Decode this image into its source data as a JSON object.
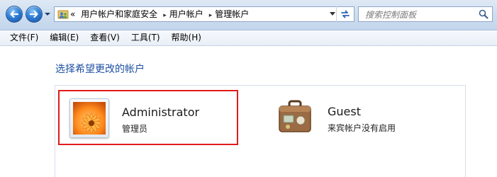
{
  "address_bar": {
    "overflow_glyph": "«",
    "breadcrumbs": [
      "用户帐户和家庭安全",
      "用户帐户",
      "管理帐户"
    ],
    "separator_glyph": "▸",
    "icons": {
      "location": "users-folder-icon",
      "refresh": "refresh-icon",
      "dropdown": "chevron-down-icon"
    }
  },
  "nav": {
    "back_icon": "back-arrow-icon",
    "forward_icon": "forward-arrow-icon",
    "history_icon": "chevron-down-icon",
    "accent_color": "#2f7fd6"
  },
  "search": {
    "placeholder": "搜索控制面板",
    "value": "",
    "icon": "search-icon"
  },
  "menu": {
    "items": [
      "文件(F)",
      "编辑(E)",
      "查看(V)",
      "工具(T)",
      "帮助(H)"
    ]
  },
  "content": {
    "heading": "选择希望更改的帐户",
    "heading_color": "#1e50a2",
    "accounts": [
      {
        "name": "Administrator",
        "role": "管理员",
        "picture": "orange-flower-picture",
        "selected": true,
        "highlight_color": "#e01c1c"
      },
      {
        "name": "Guest",
        "role": "来宾帐户没有启用",
        "picture": "suitcase-picture",
        "selected": false
      }
    ]
  }
}
